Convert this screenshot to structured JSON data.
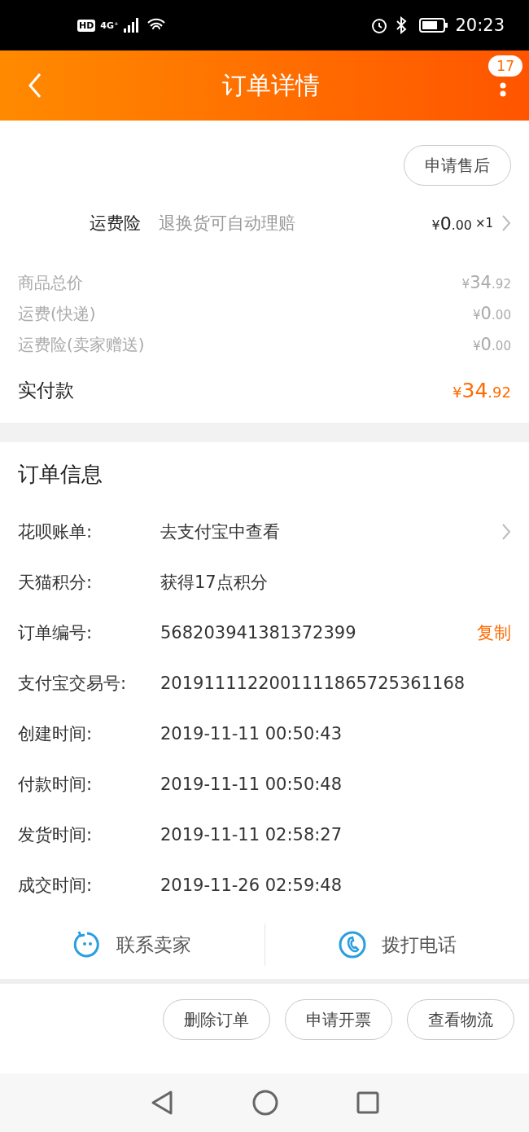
{
  "status_bar": {
    "left_badges": [
      "HD",
      "4G⁺"
    ],
    "time": "20:23"
  },
  "header": {
    "title": "订单详情",
    "badge": "17"
  },
  "after_sale_button": "申请售后",
  "insurance": {
    "label": "运费险",
    "description": "退换货可自动理赔",
    "amount": {
      "currency": "¥",
      "whole": "0",
      "fraction": ".00"
    },
    "quantity": "×1"
  },
  "price_rows": [
    {
      "label": "商品总价",
      "amount": {
        "currency": "¥",
        "whole": "34",
        "fraction": ".92"
      }
    },
    {
      "label": "运费(快递)",
      "amount": {
        "currency": "¥",
        "whole": "0",
        "fraction": ".00"
      }
    },
    {
      "label": "运费险(卖家赠送)",
      "amount": {
        "currency": "¥",
        "whole": "0",
        "fraction": ".00"
      }
    }
  ],
  "total": {
    "label": "实付款",
    "amount": {
      "currency": "¥",
      "whole": "34",
      "fraction": ".92"
    }
  },
  "order_info": {
    "title": "订单信息",
    "rows": [
      {
        "label": "花呗账单:",
        "value": "去支付宝中查看",
        "kind": "link"
      },
      {
        "label": "天猫积分:",
        "value": "获得17点积分",
        "kind": "plain"
      },
      {
        "label": "订单编号:",
        "value": "568203941381372399",
        "kind": "copy",
        "action": "复制"
      },
      {
        "label": "支付宝交易号:",
        "value": "2019111122001111865725361168",
        "kind": "plain"
      },
      {
        "label": "创建时间:",
        "value": "2019-11-11 00:50:43",
        "kind": "plain"
      },
      {
        "label": "付款时间:",
        "value": "2019-11-11 00:50:48",
        "kind": "plain"
      },
      {
        "label": "发货时间:",
        "value": "2019-11-11 02:58:27",
        "kind": "plain"
      },
      {
        "label": "成交时间:",
        "value": "2019-11-26 02:59:48",
        "kind": "plain"
      }
    ]
  },
  "contact": [
    {
      "label": "联系卖家",
      "kind": "chat"
    },
    {
      "label": "拨打电话",
      "kind": "phone"
    }
  ],
  "actions": [
    "删除订单",
    "申请开票",
    "查看物流"
  ]
}
